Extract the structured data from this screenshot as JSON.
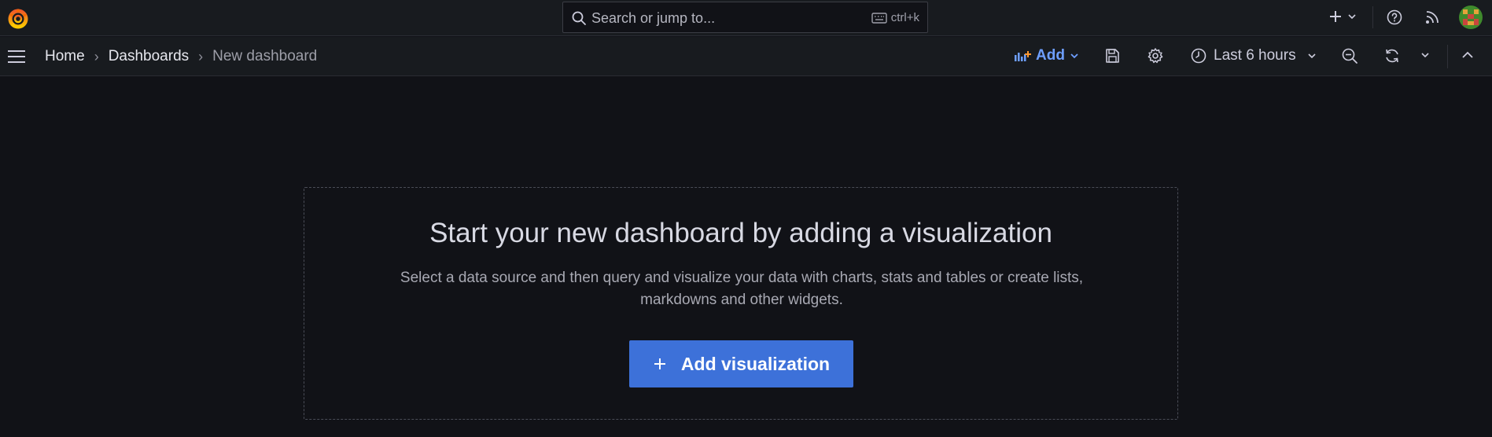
{
  "topbar": {
    "logo_icon": "grafana-logo-icon",
    "search": {
      "placeholder": "Search or jump to...",
      "shortcut": "ctrl+k"
    },
    "actions": [
      "plus-icon",
      "chevron-down-icon",
      "help-icon",
      "news-rss-icon",
      "user-avatar"
    ]
  },
  "navbar": {
    "menu_icon": "hamburger-menu-icon",
    "breadcrumbs": [
      {
        "label": "Home"
      },
      {
        "label": "Dashboards"
      },
      {
        "label": "New dashboard"
      }
    ],
    "breadcrumb_separator": "›",
    "add_label": "Add",
    "time_range": "Last 6 hours"
  },
  "empty_state": {
    "title": "Start your new dashboard by adding a visualization",
    "description_line1": "Select a data source and then query and visualize your data with charts, stats and tables or create lists,",
    "description_line2": "markdowns and other widgets.",
    "button_label": "Add visualization",
    "button_icon": "plus-icon"
  },
  "colors": {
    "background": "#111217",
    "bar": "#181b1f",
    "accent_blue": "#3d71d9",
    "link_blue": "#6e9fff",
    "logo_orange": "#f46800"
  }
}
